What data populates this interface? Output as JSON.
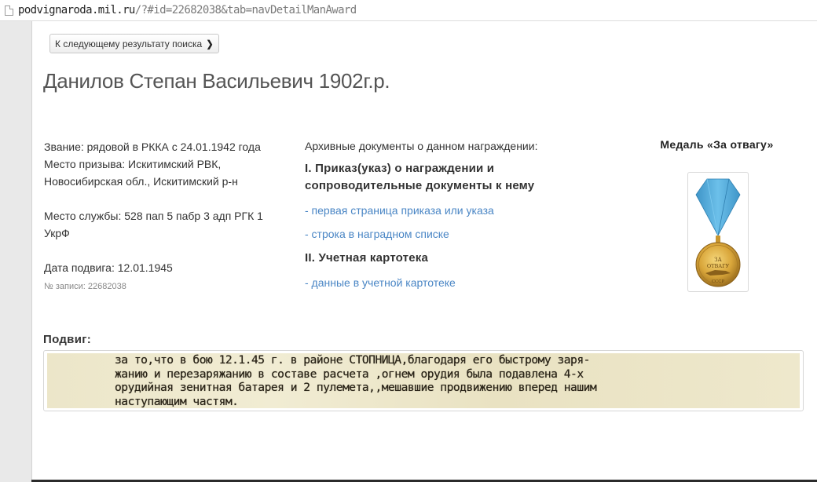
{
  "browser": {
    "url_host": "podvignaroda.mil.ru",
    "url_path": "/?#id=22682038&tab=navDetailManAward"
  },
  "nav": {
    "next_result_label": "К следующему результату поиска",
    "next_icon": "chevron-right-icon"
  },
  "person": {
    "title": "Данилов Степан Васильевич 1902г.р.",
    "rank_and_conscription": "Звание: рядовой в РККА с 24.01.1942 года Место призыва: Искитимский РВК, Новосибирская обл., Искитимский р-н",
    "service_place": "Место службы: 528 пап 5 пабр 3 адп РГК 1 УкрФ",
    "feat_date": "Дата подвига: 12.01.1945",
    "record_number": "№ записи: 22682038"
  },
  "archive": {
    "heading": "Архивные документы о данном награждении:",
    "section_1_title": "I. Приказ(указ) о награждении и сопроводительные документы к нему",
    "link_order_first_page": "- первая страница приказа или указа",
    "link_award_list_line": "- строка в наградном списке",
    "section_2_title": "II. Учетная картотека",
    "link_card_index_data": "- данные в учетной картотеке"
  },
  "award": {
    "title": "Медаль «За отвагу»",
    "medal_inscription_1": "ЗА",
    "medal_inscription_2": "ОТВАГУ",
    "medal_inscription_3": "СССР",
    "ribbon_color": "#4ea9dc",
    "medal_color": "#d8a53a"
  },
  "feat": {
    "label": "Подвиг:",
    "scan_lines": [
      "за то,что в бою 12.1.45 г. в районе СТОПНИЦА,благодаря его быстрому заря-",
      "жанию и перезаряжанию в составе расчета ,огнем орудия была подавлена 4-х",
      "орудийная зенитная батарея и 2 пулемета,,мешавшие продвижению вперед нашим",
      "наступающим частям."
    ]
  }
}
